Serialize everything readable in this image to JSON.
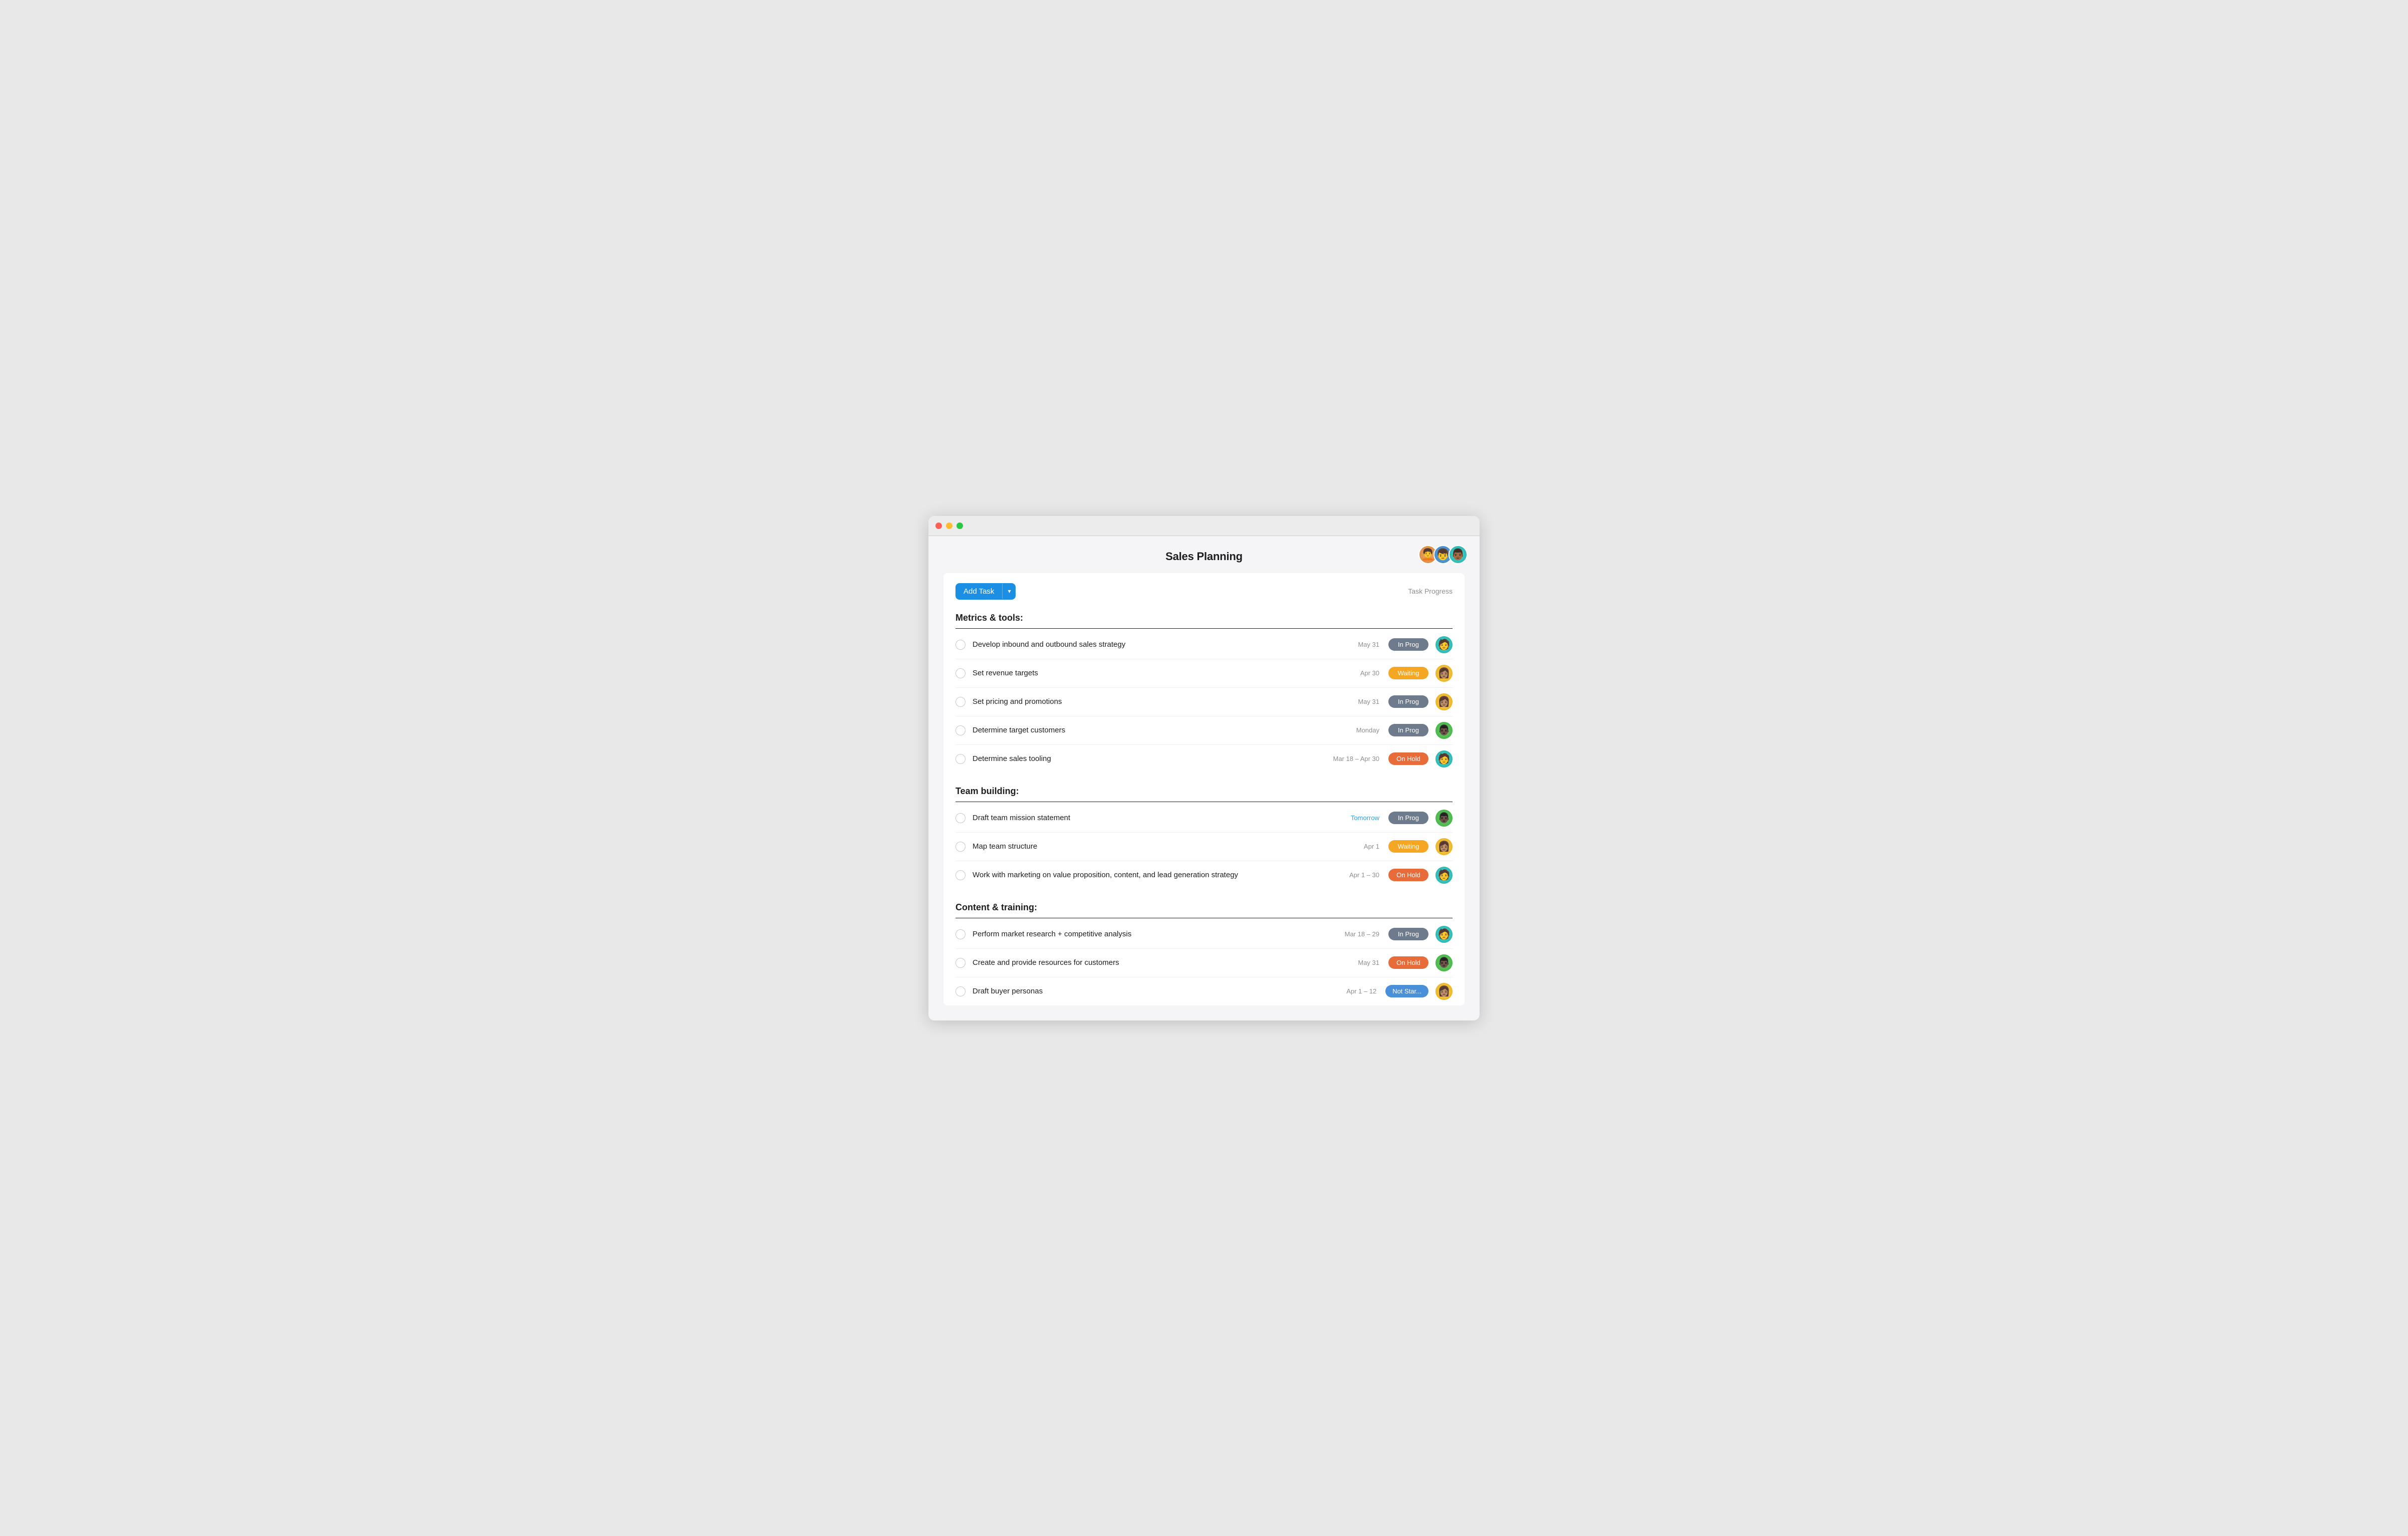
{
  "window": {
    "title": "Sales Planning"
  },
  "header": {
    "title": "Sales Planning",
    "avatars": [
      {
        "id": "avatar-1",
        "color": "av-orange",
        "emoji": "👩"
      },
      {
        "id": "avatar-2",
        "color": "av-blue",
        "emoji": "👨"
      },
      {
        "id": "avatar-3",
        "color": "av-teal",
        "emoji": "🧑"
      }
    ]
  },
  "toolbar": {
    "add_task_label": "Add Task",
    "task_progress_label": "Task Progress"
  },
  "sections": [
    {
      "id": "metrics-tools",
      "title": "Metrics & tools:",
      "tasks": [
        {
          "id": "task-1",
          "name": "Develop inbound and outbound sales strategy",
          "date": "May 31",
          "date_class": "normal",
          "status": "In Prog",
          "status_class": "status-in-prog",
          "avatar_class": "av-teal"
        },
        {
          "id": "task-2",
          "name": "Set revenue targets",
          "date": "Apr 30",
          "date_class": "normal",
          "status": "Waiting",
          "status_class": "status-waiting",
          "avatar_class": "av-yellow"
        },
        {
          "id": "task-3",
          "name": "Set pricing and promotions",
          "date": "May 31",
          "date_class": "normal",
          "status": "In Prog",
          "status_class": "status-in-prog",
          "avatar_class": "av-yellow"
        },
        {
          "id": "task-4",
          "name": "Determine target customers",
          "date": "Monday",
          "date_class": "normal",
          "status": "In Prog",
          "status_class": "status-in-prog",
          "avatar_class": "av-green"
        },
        {
          "id": "task-5",
          "name": "Determine sales tooling",
          "date": "Mar 18 – Apr 30",
          "date_class": "normal",
          "status": "On Hold",
          "status_class": "status-on-hold",
          "avatar_class": "av-teal"
        }
      ]
    },
    {
      "id": "team-building",
      "title": "Team building:",
      "tasks": [
        {
          "id": "task-6",
          "name": "Draft team mission statement",
          "date": "Tomorrow",
          "date_class": "tomorrow",
          "status": "In Prog",
          "status_class": "status-in-prog",
          "avatar_class": "av-green"
        },
        {
          "id": "task-7",
          "name": "Map team structure",
          "date": "Apr 1",
          "date_class": "normal",
          "status": "Waiting",
          "status_class": "status-waiting",
          "avatar_class": "av-yellow"
        },
        {
          "id": "task-8",
          "name": "Work with marketing on value proposition, content, and lead generation strategy",
          "date": "Apr 1 – 30",
          "date_class": "normal",
          "status": "On Hold",
          "status_class": "status-on-hold",
          "avatar_class": "av-teal"
        }
      ]
    },
    {
      "id": "content-training",
      "title": "Content & training:",
      "tasks": [
        {
          "id": "task-9",
          "name": "Perform market research + competitive analysis",
          "date": "Mar 18 – 29",
          "date_class": "normal",
          "status": "In Prog",
          "status_class": "status-in-prog",
          "avatar_class": "av-teal"
        },
        {
          "id": "task-10",
          "name": "Create and provide resources for customers",
          "date": "May 31",
          "date_class": "normal",
          "status": "On Hold",
          "status_class": "status-on-hold",
          "avatar_class": "av-green"
        },
        {
          "id": "task-11",
          "name": "Draft buyer personas",
          "date": "Apr 1 – 12",
          "date_class": "normal",
          "status": "Not Star...",
          "status_class": "status-not-started",
          "avatar_class": "av-yellow"
        }
      ]
    }
  ]
}
